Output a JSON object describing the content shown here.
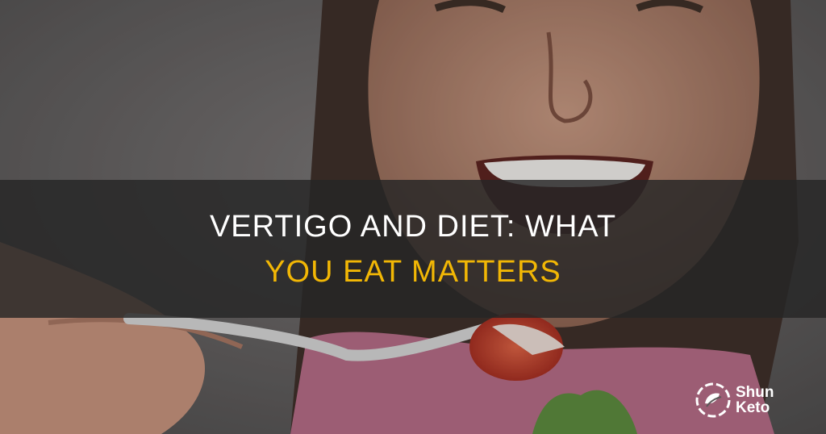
{
  "hero": {
    "alt": "Smiling woman eating a salad with a fork",
    "title_line1": "VERTIGO AND DIET: WHAT",
    "title_line2": "YOU EAT MATTERS"
  },
  "brand": {
    "name_line1": "Shun",
    "name_line2": "Keto",
    "icon": "leaf-circle-icon"
  },
  "colors": {
    "title_primary": "#ffffff",
    "title_accent": "#f2b705",
    "band": "#262626"
  }
}
